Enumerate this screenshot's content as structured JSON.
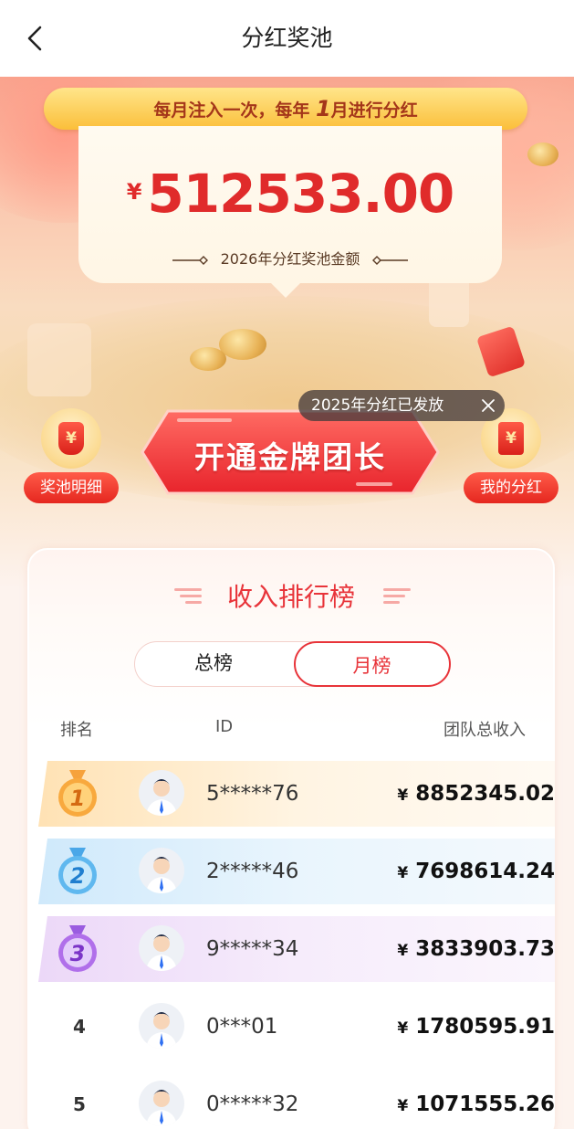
{
  "header": {
    "title": "分红奖池",
    "back_icon": "chevron-left-icon"
  },
  "banner": {
    "text_prefix": "每月注入一次，每年 ",
    "text_highlight": "1",
    "text_suffix": "月进行分红"
  },
  "pool": {
    "currency": "¥",
    "amount": "512533.00",
    "label": "2026年分红奖池金额"
  },
  "toast": {
    "text": "2025年分红已发放",
    "close_icon": "close-icon"
  },
  "actions": {
    "left_label": "奖池明细",
    "main_label": "开通金牌团长",
    "right_label": "我的分红"
  },
  "ranking": {
    "title": "收入排行榜",
    "tabs": [
      {
        "label": "总榜",
        "active": false
      },
      {
        "label": "月榜",
        "active": true
      }
    ],
    "columns": {
      "rank": "排名",
      "id": "ID",
      "income": "团队总收入"
    },
    "rows": [
      {
        "rank": "1",
        "id": "5*****76",
        "currency": "¥",
        "income": "8852345.02"
      },
      {
        "rank": "2",
        "id": "2*****46",
        "currency": "¥",
        "income": "7698614.24"
      },
      {
        "rank": "3",
        "id": "9*****34",
        "currency": "¥",
        "income": "3833903.73"
      },
      {
        "rank": "4",
        "id": "0***01",
        "currency": "¥",
        "income": "1780595.91"
      },
      {
        "rank": "5",
        "id": "0*****32",
        "currency": "¥",
        "income": "1071555.26"
      }
    ]
  },
  "colors": {
    "accent_red": "#e8343a",
    "gold": "#fbbf3a",
    "gold_row": "#fff1d6",
    "silver_row": "#e3f2fd",
    "bronze_row": "#f3e8fb"
  }
}
